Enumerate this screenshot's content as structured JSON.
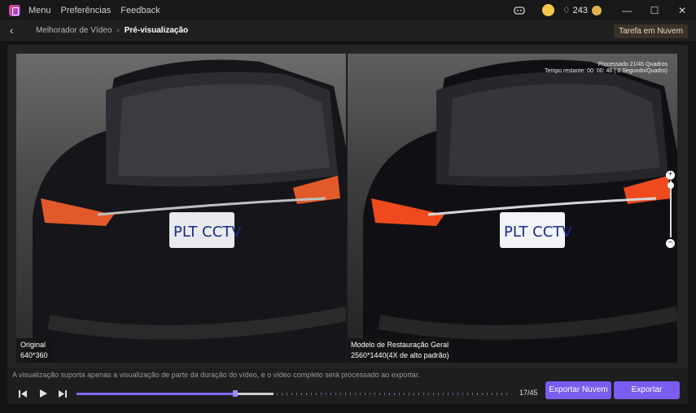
{
  "titlebar": {
    "menu": [
      "Menu",
      "Preferências",
      "Feedback"
    ],
    "credits": "243"
  },
  "nav": {
    "breadcrumb_parent": "Melhorador de Vídeo",
    "breadcrumb_current": "Pré-visualização",
    "cloud_task_label": "Tarefa em Nuvem"
  },
  "preview": {
    "original_label": "Original",
    "original_resolution": "640*360",
    "enhanced_label": "Modelo de Restauração Geral",
    "enhanced_resolution": "2560*1440(4X de alto padrão)",
    "status_processed": "Processado 21/45 Quadros",
    "status_remaining": "Tempo restante: 00: 00: 46 ( 2 Segundo/Quadro)",
    "plate_text": "PLT CCTV"
  },
  "footer": {
    "note": "A visualização suporta apenas a visualização de parte da duração do vídeo, e o vídeo completo será processado ao exportar.",
    "frame_counter": "17/45",
    "played_fraction": 0.365,
    "loaded_fraction": 0.454,
    "export_cloud_label": "Exportar Nuvem",
    "export_label": "Exportar"
  },
  "colors": {
    "accent": "#7b5cf0",
    "cloud_task_bg": "#3a3128"
  }
}
